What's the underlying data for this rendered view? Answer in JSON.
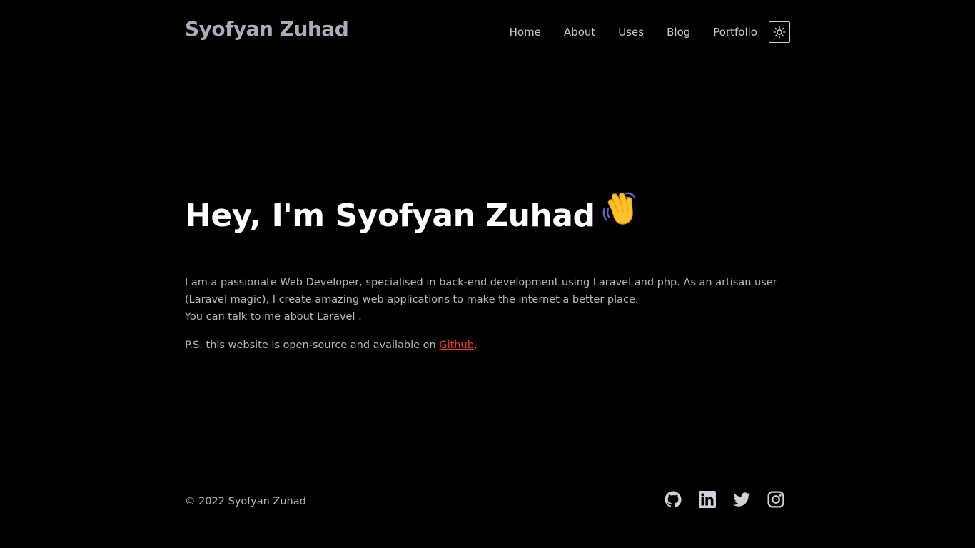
{
  "header": {
    "brand": "Syofyan Zuhad",
    "nav": [
      {
        "label": "Home"
      },
      {
        "label": "About"
      },
      {
        "label": "Uses"
      },
      {
        "label": "Blog"
      },
      {
        "label": "Portfolio"
      }
    ],
    "theme_toggle_icon": "sun-icon"
  },
  "hero": {
    "heading": "Hey, I'm Syofyan Zuhad",
    "heading_emoji_icon": "waving-hand-icon",
    "paragraph_line1": "I am a passionate Web Developer, specialised in back-end development using Laravel and php. As an artisan user (Laravel magic), I create amazing web applications to make the internet a better place.",
    "paragraph_line2": "You can talk to me about Laravel .",
    "ps_prefix": "P.S. this website is open-source and available on ",
    "ps_link": "Github",
    "ps_suffix": "."
  },
  "footer": {
    "copyright": "© 2022 Syofyan Zuhad",
    "social_icons": [
      "github-icon",
      "linkedin-icon",
      "twitter-icon",
      "instagram-icon"
    ]
  },
  "colors": {
    "background": "#000000",
    "brand": "#a9afba",
    "heading": "#ffffff",
    "body_text": "#b3b8c1",
    "link": "#e53935",
    "icon": "#cfd3d9"
  }
}
